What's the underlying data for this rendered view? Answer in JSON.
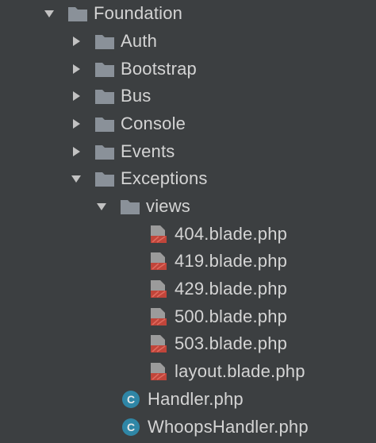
{
  "tree": {
    "root": {
      "label": "Foundation",
      "expanded": true
    },
    "children": [
      {
        "label": "Auth",
        "expanded": false
      },
      {
        "label": "Bootstrap",
        "expanded": false
      },
      {
        "label": "Bus",
        "expanded": false
      },
      {
        "label": "Console",
        "expanded": false
      },
      {
        "label": "Events",
        "expanded": false
      },
      {
        "label": "Exceptions",
        "expanded": true
      }
    ],
    "views": {
      "label": "views",
      "expanded": true
    },
    "view_files": [
      {
        "label": "404.blade.php"
      },
      {
        "label": "419.blade.php"
      },
      {
        "label": "429.blade.php"
      },
      {
        "label": "500.blade.php"
      },
      {
        "label": "503.blade.php"
      },
      {
        "label": "layout.blade.php"
      }
    ],
    "class_files": [
      {
        "label": "Handler.php",
        "badge": "C"
      },
      {
        "label": "WhoopsHandler.php",
        "badge": "C"
      }
    ]
  },
  "colors": {
    "background": "#3c3f41",
    "text": "#d4d4d4",
    "folder": "#8a9199",
    "arrow": "#c2c2c2",
    "blade_red": "#c0453a",
    "blade_gray": "#9b9b9b",
    "class_badge": "#2f86a6"
  },
  "icons": {
    "folder": "folder-icon",
    "blade": "blade-file-icon",
    "class": "php-class-icon",
    "collapsed": "chevron-right-icon",
    "expanded": "chevron-down-icon"
  }
}
